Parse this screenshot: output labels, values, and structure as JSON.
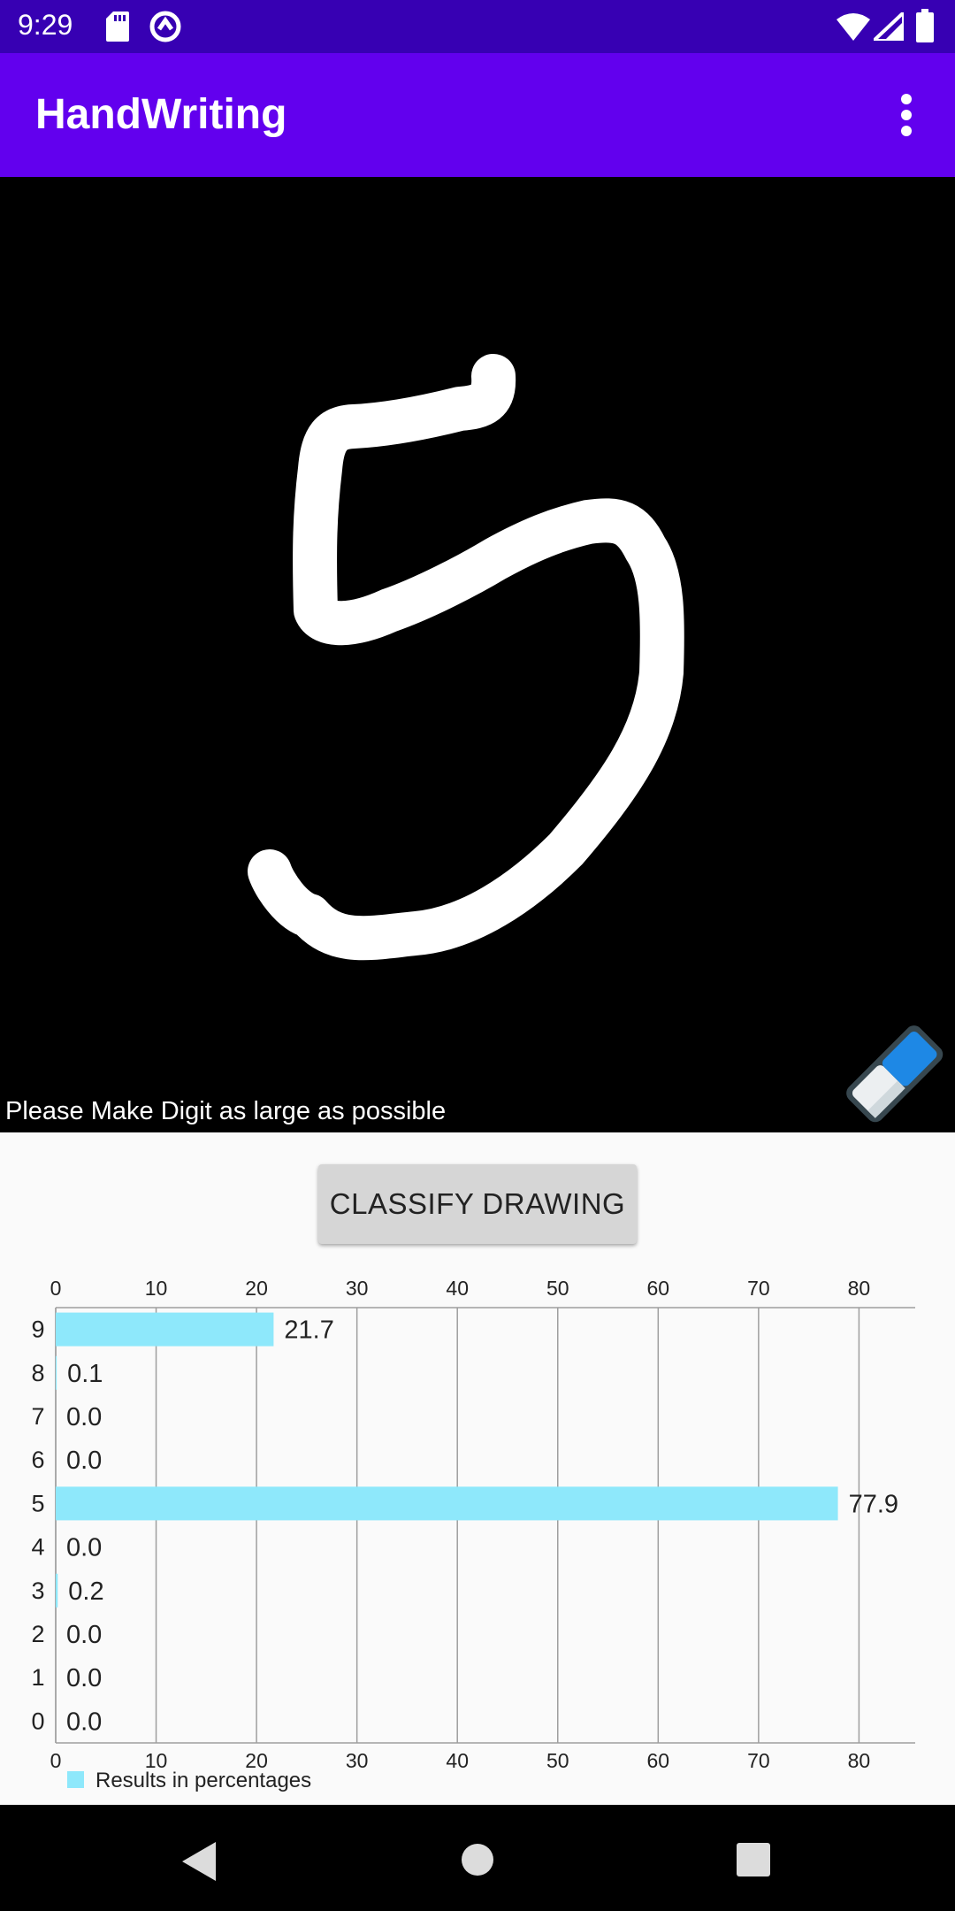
{
  "status_bar": {
    "time": "9:29",
    "icons": [
      "sd-card-icon",
      "sync-icon",
      "wifi-icon",
      "cell-signal-icon",
      "battery-icon"
    ]
  },
  "app_bar": {
    "title": "HandWriting",
    "menu_icon": "more-vert-icon"
  },
  "canvas": {
    "hint": "Please Make Digit as large as possible",
    "eraser_icon": "eraser-icon",
    "background": "#000000",
    "stroke_color": "#ffffff"
  },
  "classify_button": {
    "label": "CLASSIFY DRAWING"
  },
  "chart_data": {
    "type": "bar",
    "orientation": "horizontal",
    "categories": [
      "9",
      "8",
      "7",
      "6",
      "5",
      "4",
      "3",
      "2",
      "1",
      "0"
    ],
    "series": [
      {
        "name": "Results in percentages",
        "values": [
          21.7,
          0.1,
          0.0,
          0.0,
          77.9,
          0.0,
          0.2,
          0.0,
          0.0,
          0.0
        ],
        "color": "#8ee8fb"
      }
    ],
    "value_labels": [
      "21.7",
      "0.1",
      "0.0",
      "0.0",
      "77.9",
      "0.0",
      "0.2",
      "0.0",
      "0.0",
      "0.0"
    ],
    "xlim": [
      0,
      85.6
    ],
    "xticks": [
      "0",
      "10",
      "20",
      "30",
      "40",
      "50",
      "60",
      "70",
      "80"
    ],
    "grid": true,
    "legend": "bottom-left"
  },
  "nav_bar": {
    "icons": [
      "back-icon",
      "home-icon",
      "recents-icon"
    ]
  },
  "colors": {
    "status_bar": "#3700b3",
    "app_bar": "#6200ee",
    "bar": "#8ee8fb"
  }
}
